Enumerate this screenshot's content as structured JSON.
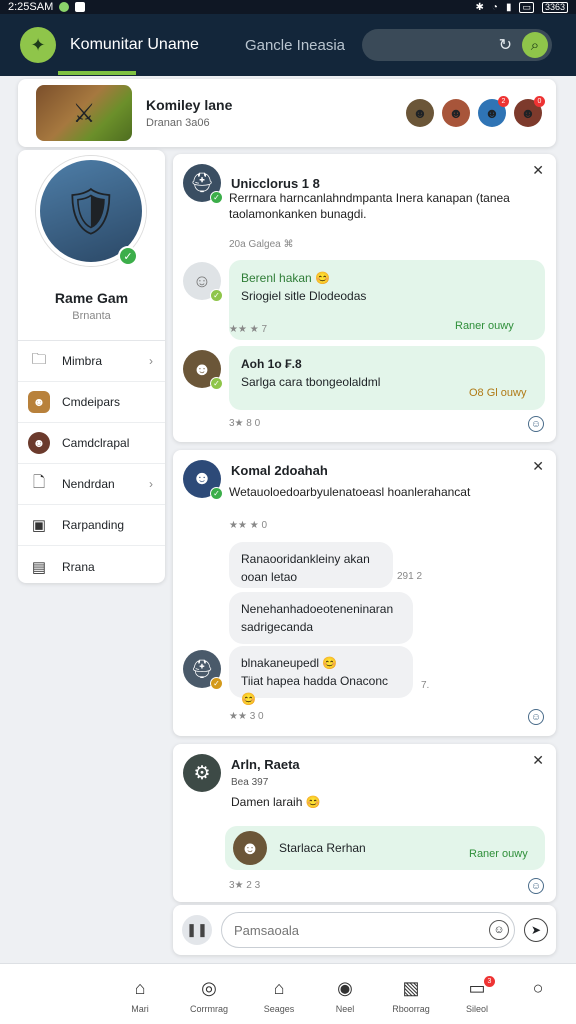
{
  "status": {
    "time": "2:25SAM",
    "battery": "3363"
  },
  "app": {
    "title": "Komunitar Uname",
    "tab2": "Gancle Ineasia",
    "search_placeholder": ""
  },
  "group": {
    "name": "Komiley lane",
    "sub": "Dranan 3a06"
  },
  "profile": {
    "name": "Rame Gam",
    "sub": "Brnanta"
  },
  "menu": {
    "items": [
      {
        "label": "Mimbra"
      },
      {
        "label": "Cmdeipars"
      },
      {
        "label": "Camdclrapal"
      },
      {
        "label": "Nendrdan"
      },
      {
        "label": "Rarpanding"
      },
      {
        "label": "Rrana"
      }
    ]
  },
  "post1": {
    "title": "Unicclorus 1 8",
    "text1": "Rerrnara harncanlahndmpanta Inera kanapan (tanea",
    "text2": "taolamonkanken bunagdi.",
    "meta": "20a Galgea ⌘",
    "b1_title": "Berenl hakan 😊",
    "b1_text": "Sriogiel sitle Dlodeodas",
    "b1_label": "Raner ouwy",
    "meta2": "★★ ★ 7",
    "b2_title": "Aoh 1o ₣.8",
    "b2_text": "Sarlga cara tbongeolaldml",
    "b2_label": "O8 Gl ouwy",
    "meta3": "3★ 8 0"
  },
  "post2": {
    "title": "Komal 2doahah",
    "text": "Wetauoloedoarbyulenatoeasl hoanlerahancat",
    "meta": "★★ ★ 0",
    "c1_line1": "Ranaooridankleiny akan",
    "c1_line2": "ooan letao",
    "c1_time": "291 2",
    "c2_line1": "Nenehanhadoeoteneninaran",
    "c2_line2": "sadrigecanda",
    "c3_line1": "blnakaneupedl 😊",
    "c3_line2": "Tiiat hapea hadda Onaconc 😊",
    "c3_time": "7.",
    "meta2": "★★ 3 0"
  },
  "post3": {
    "title": "Arln, Raeta",
    "sub": "Bea 397",
    "text": "Damen laraih 😊",
    "reply": "Starlaca Rerhan",
    "reply_label": "Raner ouwy",
    "meta": "3★ 2 3"
  },
  "compose": {
    "placeholder": "Pamsaoala"
  },
  "nav": {
    "items": [
      {
        "label": "Mari"
      },
      {
        "label": "Corrmrag"
      },
      {
        "label": "Seages"
      },
      {
        "label": "Neel"
      },
      {
        "label": "Rboorrag"
      },
      {
        "label": "Sileol"
      },
      {
        "label": ""
      }
    ],
    "badge": "3"
  }
}
